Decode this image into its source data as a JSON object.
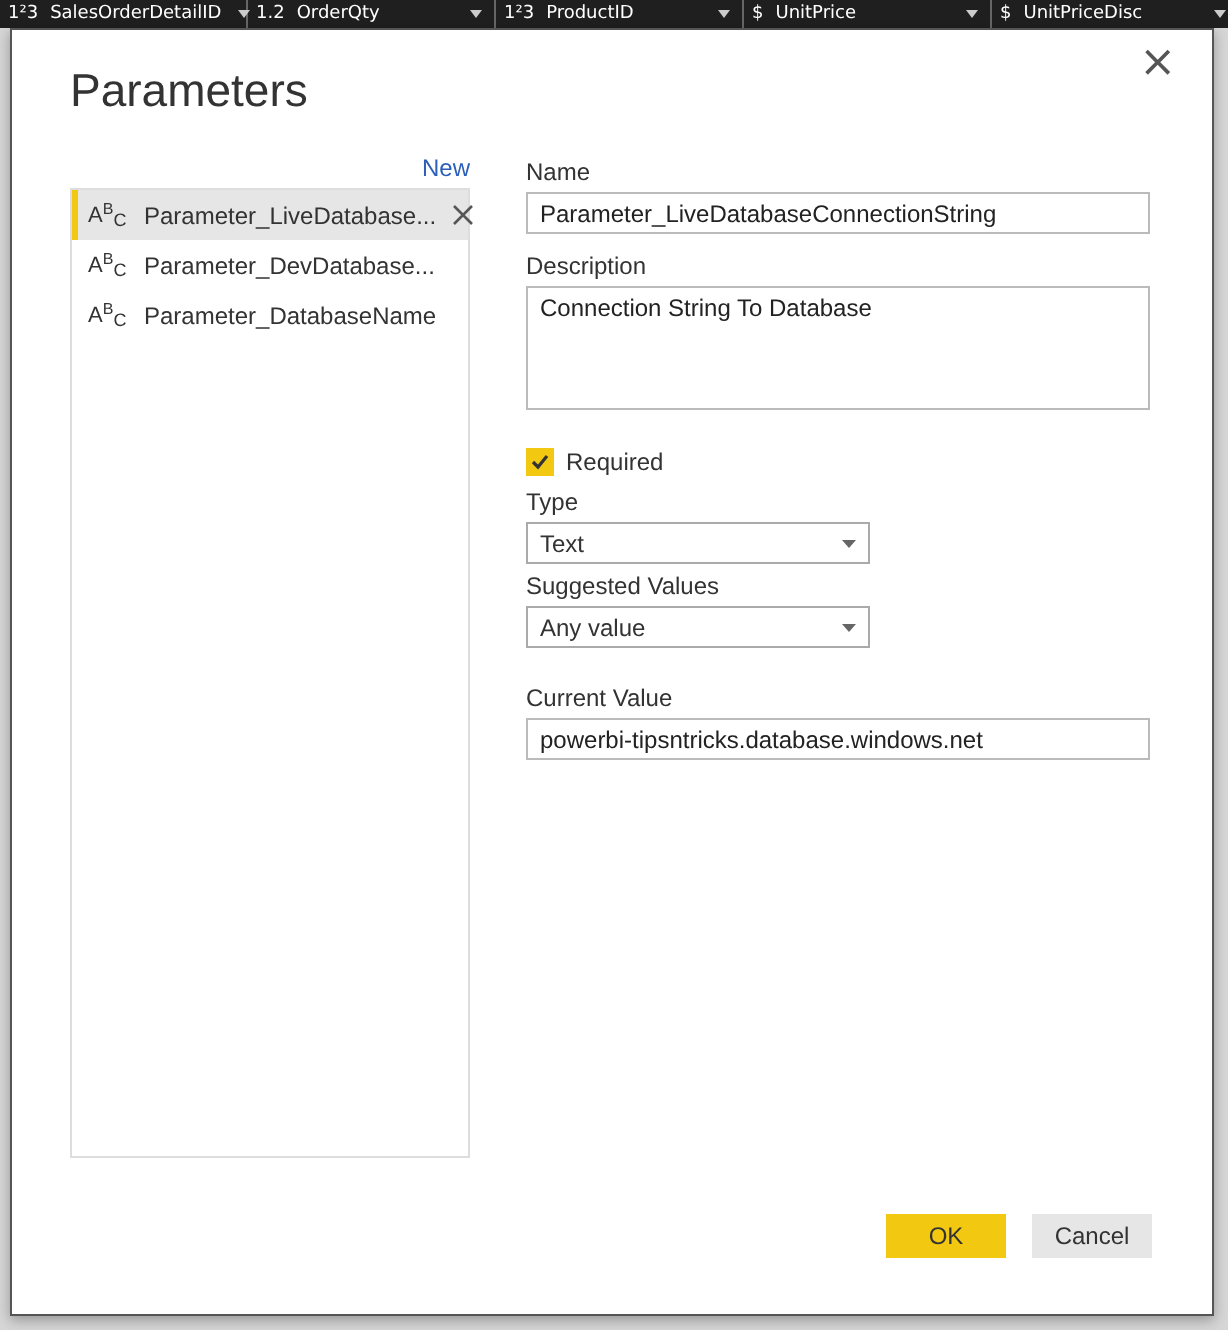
{
  "background_table": {
    "columns": [
      {
        "type_icon": "1²3",
        "label": "SalesOrderDetailID"
      },
      {
        "type_icon": "1.2",
        "label": "OrderQty"
      },
      {
        "type_icon": "1²3",
        "label": "ProductID"
      },
      {
        "type_icon": "$",
        "label": "UnitPrice"
      },
      {
        "type_icon": "$",
        "label": "UnitPriceDisc"
      }
    ]
  },
  "dialog": {
    "title": "Parameters",
    "close": "×",
    "new_link": "New",
    "parameters": [
      {
        "type_icon": "A$^{B}$$_{C}$",
        "name": "Parameter_LiveDatabase...",
        "selected": true
      },
      {
        "type_icon": "A$^{B}$$_{C}$",
        "name": "Parameter_DevDatabase...",
        "selected": false
      },
      {
        "type_icon": "A$^{B}$$_{C}$",
        "name": "Parameter_DatabaseName",
        "selected": false
      }
    ],
    "form": {
      "name_label": "Name",
      "name_value": "Parameter_LiveDatabaseConnectionString",
      "description_label": "Description",
      "description_value": "Connection String To Database",
      "required": {
        "label": "Required",
        "checked": true
      },
      "type_label": "Type",
      "type_value": "Text",
      "suggested_label": "Suggested Values",
      "suggested_value": "Any value",
      "current_label": "Current Value",
      "current_value": "powerbi-tipsntricks.database.windows.net"
    },
    "buttons": [
      {
        "label": "OK",
        "kind": "primary"
      },
      {
        "label": "Cancel",
        "kind": "secondary"
      }
    ]
  }
}
